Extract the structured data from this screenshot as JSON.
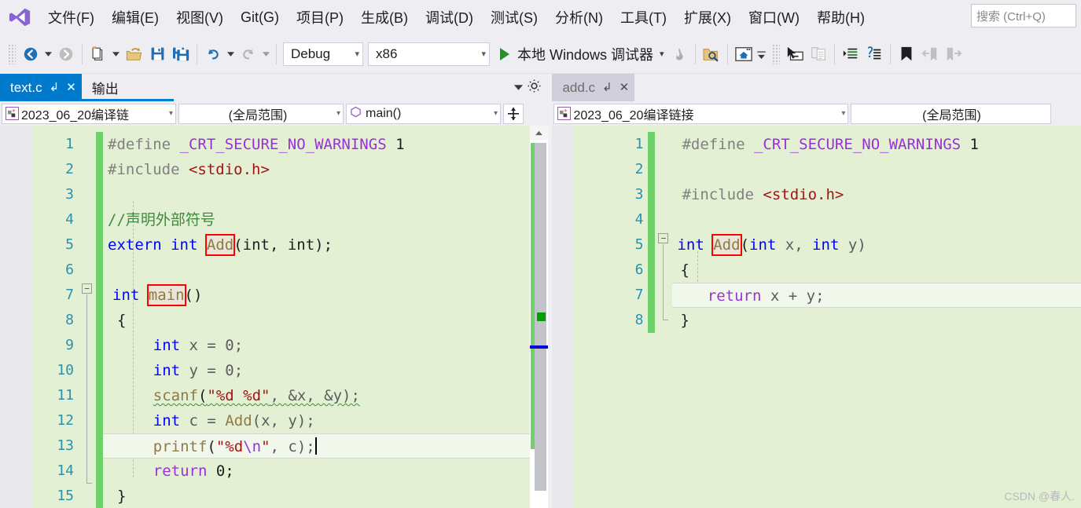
{
  "app": {
    "logo_icon": "visual-studio-logo",
    "watermark": "CSDN @春人."
  },
  "menu": {
    "items": [
      {
        "label": "文件(F)",
        "name": "file"
      },
      {
        "label": "编辑(E)",
        "name": "edit"
      },
      {
        "label": "视图(V)",
        "name": "view"
      },
      {
        "label": "Git(G)",
        "name": "git"
      },
      {
        "label": "项目(P)",
        "name": "project"
      },
      {
        "label": "生成(B)",
        "name": "build"
      },
      {
        "label": "调试(D)",
        "name": "debug"
      },
      {
        "label": "测试(S)",
        "name": "test"
      },
      {
        "label": "分析(N)",
        "name": "analyze"
      },
      {
        "label": "工具(T)",
        "name": "tools"
      },
      {
        "label": "扩展(X)",
        "name": "extensions"
      },
      {
        "label": "窗口(W)",
        "name": "window"
      },
      {
        "label": "帮助(H)",
        "name": "help"
      }
    ],
    "search_placeholder": "搜索 (Ctrl+Q)"
  },
  "toolbar": {
    "config_value": "Debug",
    "platform_value": "x86",
    "run_label": "本地 Windows 调试器",
    "icons": [
      "navigate-back-icon",
      "navigate-forward-icon",
      "new-file-icon",
      "open-file-icon",
      "save-icon",
      "save-all-icon",
      "undo-icon",
      "redo-icon",
      "start-debug-icon",
      "hot-reload-icon",
      "solution-explorer-search-icon",
      "home-icon",
      "select-element-icon",
      "copy-lines-icon",
      "increase-indent-icon",
      "comment-icon",
      "bookmark-icon",
      "previous-bookmark-icon",
      "next-bookmark-icon"
    ]
  },
  "left_pane": {
    "tabs": [
      {
        "label": "text.c",
        "state": "active",
        "pin": "↲",
        "close": "✕"
      },
      {
        "label": "输出",
        "state": "plain"
      }
    ],
    "nav": {
      "project": "2023_06_20编译链",
      "project_icon": "project-icon",
      "scope": "(全局范围)",
      "function": "main()",
      "function_icon": "method-icon",
      "split_icon": "split-view-icon"
    },
    "code": {
      "lines": [
        "1",
        "2",
        "3",
        "4",
        "5",
        "6",
        "7",
        "8",
        "9",
        "10",
        "11",
        "12",
        "13",
        "14",
        "15"
      ],
      "current_line": 13,
      "source": [
        "#define _CRT_SECURE_NO_WARNINGS 1",
        "#include <stdio.h>",
        "",
        "//声明外部符号",
        "extern int Add(int, int);",
        "",
        "int main()",
        "{",
        "    int x = 0;",
        "    int y = 0;",
        "    scanf(\"%d %d\", &x, &y);",
        "    int c = Add(x, y);",
        "    printf(\"%d\\n\", c);",
        "    return 0;",
        "}"
      ]
    }
  },
  "right_pane": {
    "tabs": [
      {
        "label": "add.c",
        "state": "inactive-sel",
        "pin": "↲",
        "close": "✕"
      }
    ],
    "nav": {
      "project": "2023_06_20编译链接",
      "project_icon": "project-icon",
      "scope": "(全局范围)"
    },
    "code": {
      "lines": [
        "1",
        "2",
        "3",
        "4",
        "5",
        "6",
        "7",
        "8"
      ],
      "current_line": 7,
      "source": [
        "#define _CRT_SECURE_NO_WARNINGS 1",
        "",
        "#include <stdio.h>",
        "",
        "int Add(int x, int y)",
        "{",
        "    return x + y;",
        "}"
      ]
    }
  },
  "tokens": {
    "define_1": "#define",
    "crt_macro": "_CRT_SECURE_NO_WARNINGS",
    "one": "1",
    "include_1": "#include",
    "stdio": "<stdio.h>",
    "comment_extern": "//声明外部符号",
    "extern_kw": "extern",
    "int_kw": "int",
    "add_name": "Add",
    "add_proto_args": "(int, int);",
    "main_name": "main",
    "main_parens": "()",
    "brace_open": "{",
    "brace_close": "}",
    "decl_x": "x = 0;",
    "decl_y": "y = 0;",
    "scanf_name": "scanf",
    "scanf_fmt": "\"%d %d\"",
    "scanf_args": ", &x, &y);",
    "decl_c": "c = ",
    "add_call": "Add",
    "add_call_args": "(x, y);",
    "printf_name": "printf",
    "printf_open": "(",
    "printf_fmt_a": "\"%d",
    "printf_fmt_esc": "\\n",
    "printf_fmt_b": "\"",
    "printf_args": ", c);",
    "return_kw": "return",
    "zero_semi": "0;",
    "add_def_args_open": "(",
    "add_def_int1": "int",
    "add_def_x": " x, ",
    "add_def_int2": "int",
    "add_def_y": " y)",
    "return_expr": "x + y;"
  },
  "colors": {
    "accent_blue": "#007acc",
    "editor_bg": "#e3f0d4",
    "change_bar": "#6ed169",
    "highlight_box": "#ff0000",
    "line_number": "#2b91af",
    "chrome_bg": "#eeeef2"
  }
}
